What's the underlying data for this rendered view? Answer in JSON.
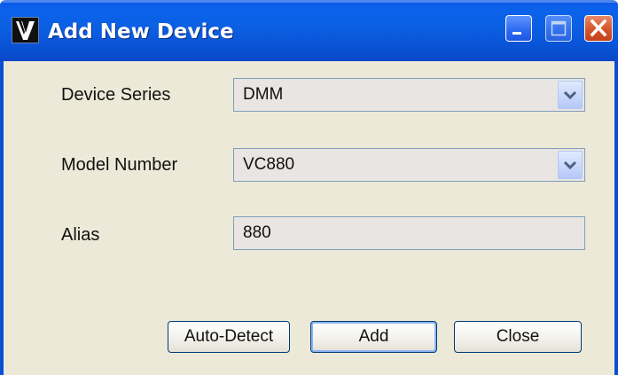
{
  "window": {
    "title": "Add New Device",
    "app_icon_glyph": "V",
    "controls": {
      "minimize": "minimize-icon",
      "maximize": "maximize-icon",
      "close": "close-icon"
    }
  },
  "form": {
    "device_series": {
      "label": "Device Series",
      "value": "DMM"
    },
    "model_number": {
      "label": "Model Number",
      "value": "VC880"
    },
    "alias": {
      "label": "Alias",
      "value": "880"
    }
  },
  "buttons": {
    "auto_detect": "Auto-Detect",
    "add": "Add",
    "close": "Close"
  },
  "colors": {
    "titlebar": "#0a58e6",
    "client_bg": "#ece9d8",
    "field_border": "#7f9db9",
    "close_button": "#d6532a"
  }
}
